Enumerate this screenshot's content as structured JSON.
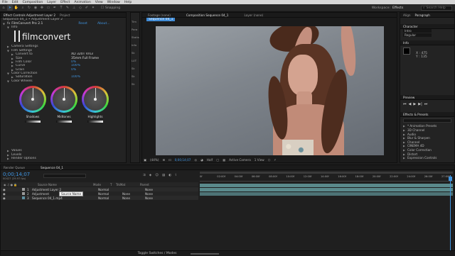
{
  "menu": [
    "File",
    "Edit",
    "Composition",
    "Layer",
    "Effect",
    "Animation",
    "View",
    "Window",
    "Help"
  ],
  "toolbar": {
    "snapping": "Snapping",
    "workspace_label": "Workspace:",
    "workspace_value": "Effects",
    "search_placeholder": "Search Help"
  },
  "effect_controls": {
    "tabs": [
      "Effect Controls Adjustment Layer 2",
      "Project"
    ],
    "breadcrumb": "Sequence 04_1 • Adjustment Layer 2",
    "effect_name": "FilmConvert Pro 2.1",
    "reset": "Reset",
    "about": "About...",
    "info": "Info",
    "logo_text": "filmconvert",
    "props": [
      {
        "t": "Camera Settings",
        "v": ""
      },
      {
        "t": "Film Settings",
        "v": ""
      },
      {
        "t": "Convert to",
        "v": "XD 320T Vrs3"
      },
      {
        "t": "Size",
        "v": "35mm Full Frame"
      },
      {
        "t": "Film Color",
        "v": "0%"
      },
      {
        "t": "Curve",
        "v": "100%"
      },
      {
        "t": "Grain",
        "v": "0%"
      },
      {
        "t": "Color Correction",
        "v": ""
      },
      {
        "t": "Saturation",
        "v": "100%"
      },
      {
        "t": "Color Wheels",
        "v": ""
      }
    ],
    "wheels": [
      "Shadows",
      "Midtones",
      "Highlights"
    ],
    "bottom": [
      "Values",
      "Levels",
      "Render Options"
    ]
  },
  "composition": {
    "tabs": [
      "Footage (none)",
      "Composition Sequence 04_1",
      "Layer (none)"
    ],
    "comp_tab": "Sequence 04_1",
    "zoom": "(44%)",
    "timecode": "0;00;14;07",
    "resolution": "Half",
    "camera": "Active Camera",
    "view": "1 View"
  },
  "side_strip": [
    "Tim",
    "Para",
    "Statis",
    "Info",
    "Sk",
    "LUT",
    "Sk",
    "Sk",
    "Sk"
  ],
  "right": {
    "align": "Align",
    "paragraph": "Paragraph",
    "character": "Character",
    "font": "Intro",
    "style": "Regular",
    "info": "Info",
    "info_vals": [
      "X : 475",
      "Y : 135"
    ],
    "preview": "Preview",
    "effects": "Effects & Presets",
    "effects_list": [
      "* Animation Presets",
      "3D Channel",
      "Audio",
      "Blur & Sharpen",
      "Channel",
      "CINEMA 4D",
      "Color Correction",
      "Distort",
      "Expression Controls"
    ]
  },
  "timeline": {
    "tabs": [
      "Render Queue",
      "Sequence 04_1"
    ],
    "timecode": "0;00;14;07",
    "fps": "00427 (29.97 fps)",
    "headers": [
      "Source Name",
      "Mode",
      "T",
      "TrkMat",
      "Parent"
    ],
    "layers": [
      {
        "num": "1",
        "name": "Adjustment Layer 2",
        "mode": "Normal",
        "trk": "",
        "parent": "None"
      },
      {
        "num": "2",
        "name": "Adjustment",
        "mode": "Normal",
        "trk": "None",
        "parent": "None"
      },
      {
        "num": "3",
        "name": "Sequence 04_1.mp4",
        "mode": "Normal",
        "trk": "None",
        "parent": "None"
      }
    ],
    "tooltip": "Source Name",
    "ticks": [
      "0f",
      "02:00f",
      "04:00f",
      "06:00f",
      "08:00f",
      "10:00f",
      "12:00f",
      "14:00f",
      "16:00f",
      "18:00f",
      "20:00f",
      "22:00f",
      "24:00f",
      "26:00f",
      "27:00f"
    ],
    "footer": "Toggle Switches / Modes"
  }
}
